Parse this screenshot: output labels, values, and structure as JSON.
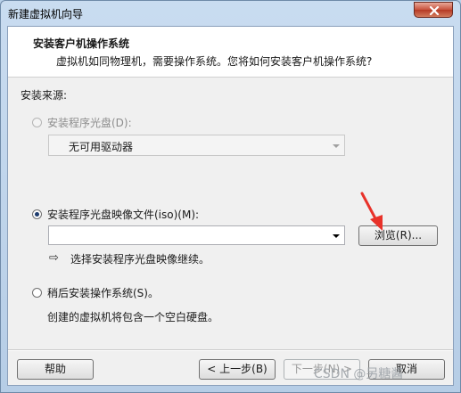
{
  "window": {
    "title": "新建虚拟机向导"
  },
  "header": {
    "title": "安装客户机操作系统",
    "description": "虚拟机如同物理机，需要操作系统。您将如何安装客户机操作系统?"
  },
  "source": {
    "label": "安装来源:",
    "disc_option": {
      "label": "安装程序光盘(D):",
      "selected": false,
      "enabled": false
    },
    "disc_drive": {
      "value": "无可用驱动器",
      "enabled": false
    },
    "iso_option": {
      "label": "安装程序光盘映像文件(iso)(M):",
      "selected": true
    },
    "iso_path": {
      "value": ""
    },
    "browse_label": "浏览(R)...",
    "hint": "选择安装程序光盘映像继续。",
    "later_option": {
      "label": "稍后安装操作系统(S)。",
      "selected": false
    },
    "later_desc": "创建的虚拟机将包含一个空白硬盘。"
  },
  "footer": {
    "help_label": "帮助",
    "back_label": "< 上一步(B)",
    "next_label": "下一步(N) >",
    "cancel_label": "取消"
  },
  "watermark": "CSDN @另糖酱",
  "colors": {
    "annotation_arrow": "#e8322a",
    "title_bar": "#c9dcf0"
  },
  "icons": {
    "close": "close-icon",
    "hint": "right-arrow-icon",
    "annotation": "red-arrow-icon"
  }
}
